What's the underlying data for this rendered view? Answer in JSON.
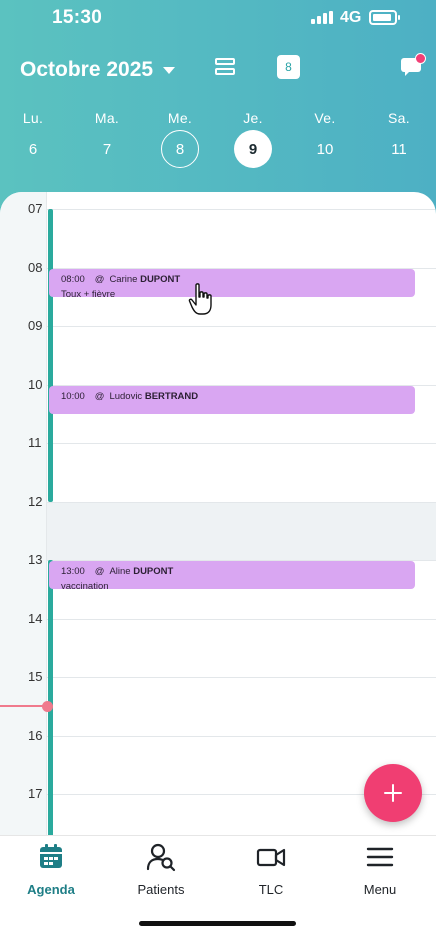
{
  "status": {
    "time": "15:30",
    "network": "4G",
    "battery_level": 0.9
  },
  "header": {
    "month": "Octobre 2025",
    "today_badge": "8"
  },
  "week": [
    {
      "name": "Lu.",
      "num": "6",
      "state": "normal"
    },
    {
      "name": "Ma.",
      "num": "7",
      "state": "normal"
    },
    {
      "name": "Me.",
      "num": "8",
      "state": "today"
    },
    {
      "name": "Je.",
      "num": "9",
      "state": "selected"
    },
    {
      "name": "Ve.",
      "num": "10",
      "state": "normal"
    },
    {
      "name": "Sa.",
      "num": "11",
      "state": "normal"
    }
  ],
  "agenda": {
    "hours": [
      "07",
      "08",
      "09",
      "10",
      "11",
      "12",
      "13",
      "14",
      "15",
      "16",
      "17"
    ],
    "current_time": "15:30",
    "appointments": [
      {
        "time": "08:00",
        "first": "Carine",
        "last": "DUPONT",
        "reason": "Toux + fièvre"
      },
      {
        "time": "10:00",
        "first": "Ludovic",
        "last": "BERTRAND",
        "reason": ""
      },
      {
        "time": "13:00",
        "first": "Aline",
        "last": "DUPONT",
        "reason": "vaccination"
      }
    ]
  },
  "nav": [
    {
      "label": "Agenda",
      "icon": "calendar-icon",
      "active": true
    },
    {
      "label": "Patients",
      "icon": "patients-icon",
      "active": false
    },
    {
      "label": "TLC",
      "icon": "video-icon",
      "active": false
    },
    {
      "label": "Menu",
      "icon": "menu-icon",
      "active": false
    }
  ],
  "colors": {
    "accent": "#2aa3a7",
    "appointment": "#d9a6f2",
    "fab": "#f03e72",
    "now_line": "#f07a8d",
    "availability": "#2aaa9d"
  }
}
